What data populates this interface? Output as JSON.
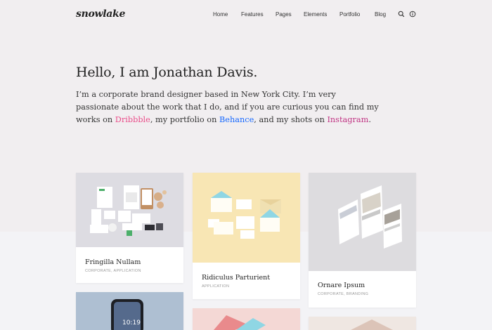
{
  "brand": {
    "logo": "snowlake"
  },
  "nav": {
    "items": [
      "Home",
      "Features",
      "Pages",
      "Elements",
      "Portfolio",
      "Blog"
    ],
    "icons": [
      "search-icon",
      "info-icon"
    ]
  },
  "hero": {
    "title": "Hello, I am Jonathan Davis.",
    "line1": "I’m a corporate brand designer based in New York City. I’m very",
    "line2": "passionate about the work that I do, and if you are curious you can find my",
    "line3_prefix": "works on ",
    "dribbble": "Dribbble",
    "line3_mid1": ", my portfolio on ",
    "behance": "Behance",
    "line3_mid2": ", and my shots on ",
    "instagram": "Instagram",
    "line3_suffix": ".",
    "colors": {
      "dribbble": "#ea4c89",
      "behance": "#1769ff",
      "instagram": "#c13584"
    }
  },
  "portfolio": [
    {
      "title": "Fringilla Nullam",
      "categories": "CORPORATE, APPLICATION"
    },
    {
      "title": "Ridiculus Parturient",
      "categories": "APPLICATION"
    },
    {
      "title": "Ornare Ipsum",
      "categories": "CORPORATE, BRANDING"
    }
  ],
  "phone_time": "10:19"
}
